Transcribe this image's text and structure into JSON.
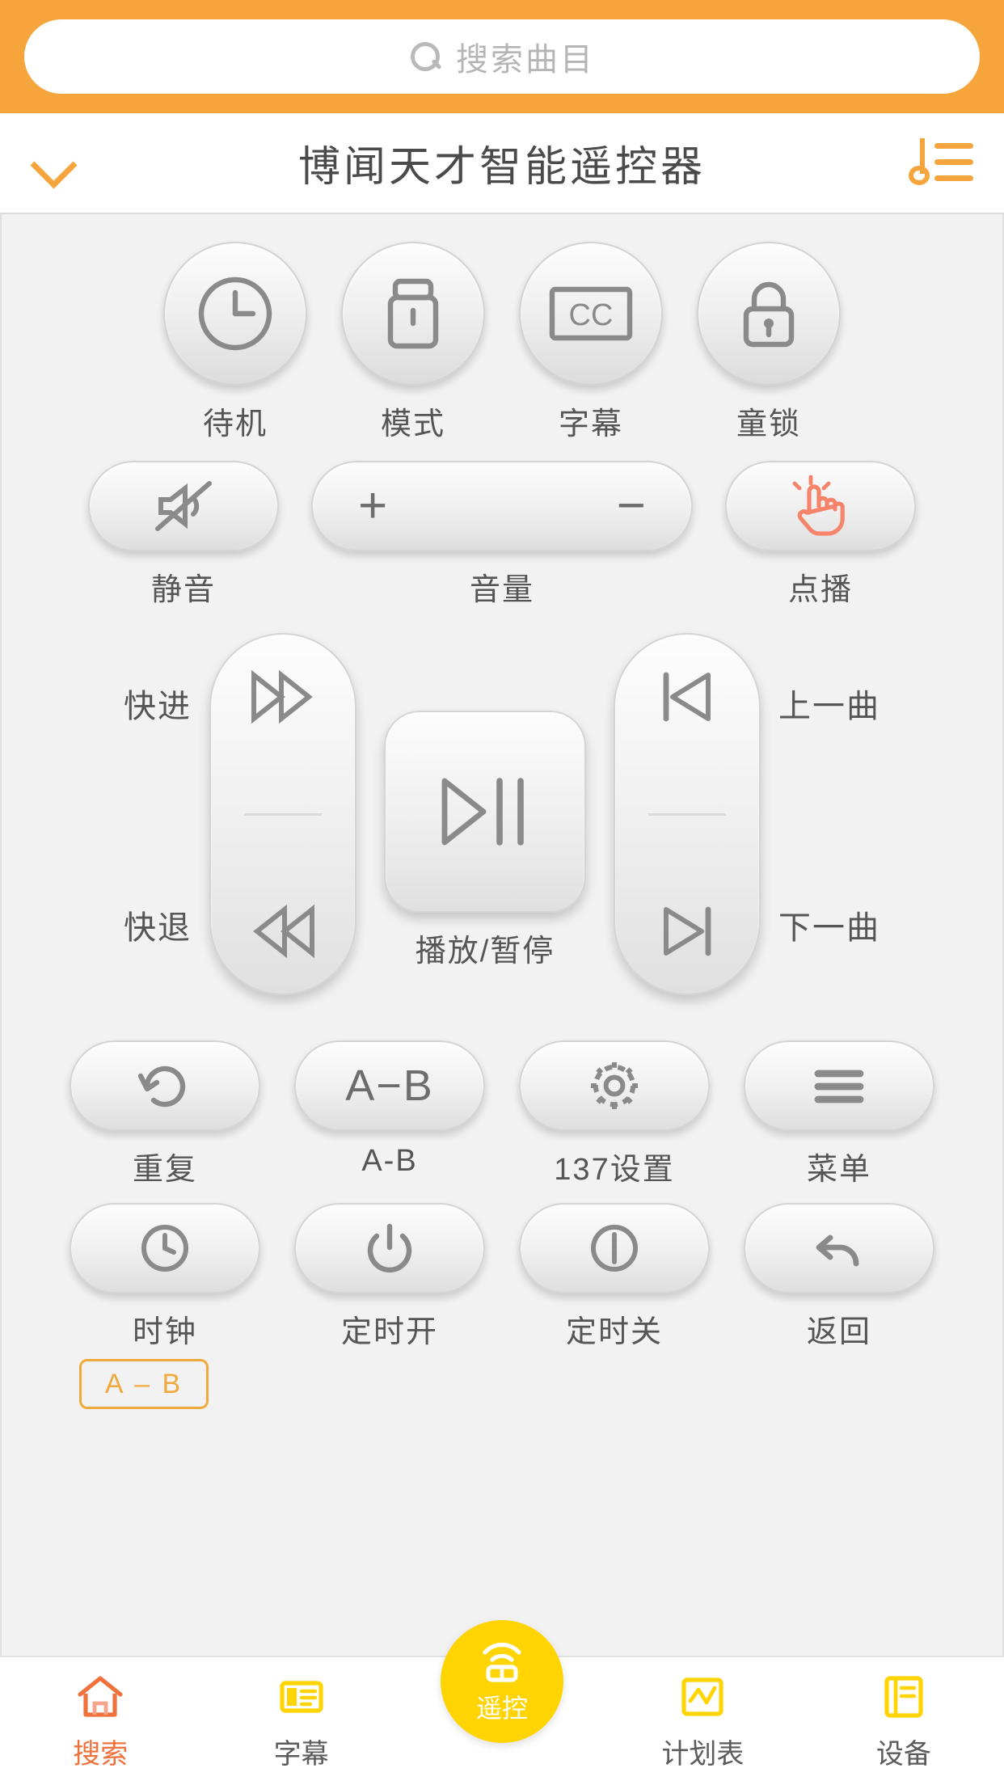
{
  "search": {
    "placeholder": "搜索曲目",
    "icon": "search-icon"
  },
  "header": {
    "title": "博闻天才智能遥控器",
    "back_icon": "chevron-down-icon",
    "playlist_icon": "music-list-icon"
  },
  "remote": {
    "row1": [
      {
        "label": "待机",
        "icon": "clock-power-icon"
      },
      {
        "label": "模式",
        "icon": "usb-drive-icon"
      },
      {
        "label": "字幕",
        "icon": "cc-icon"
      },
      {
        "label": "童锁",
        "icon": "lock-icon"
      }
    ],
    "row2": {
      "mute": {
        "label": "静音",
        "icon": "mute-icon"
      },
      "volume": {
        "label": "音量",
        "plus": "+",
        "minus": "−"
      },
      "demand": {
        "label": "点播",
        "icon": "hand-tap-icon"
      }
    },
    "transport": {
      "left_top_label": "快进",
      "left_bottom_label": "快退",
      "right_top_label": "上一曲",
      "right_bottom_label": "下一曲",
      "center_label": "播放/暂停"
    },
    "grid": [
      {
        "label": "重复",
        "icon": "repeat-icon"
      },
      {
        "label": "A-B",
        "icon": "a-b-text",
        "text": "A−B"
      },
      {
        "label": "137设置",
        "icon": "gear-icon"
      },
      {
        "label": "菜单",
        "icon": "menu-icon"
      },
      {
        "label": "时钟",
        "icon": "clock-icon"
      },
      {
        "label": "定时开",
        "icon": "power-on-icon"
      },
      {
        "label": "定时关",
        "icon": "power-off-icon"
      },
      {
        "label": "返回",
        "icon": "back-arrow-icon"
      }
    ],
    "ab_tag": "A – B"
  },
  "tabbar": {
    "items": [
      {
        "label": "搜索",
        "icon": "home-icon",
        "active": true
      },
      {
        "label": "字幕",
        "icon": "subtitle-icon",
        "active": false
      },
      {
        "label": "遥控",
        "icon": "remote-icon",
        "active": false
      },
      {
        "label": "计划表",
        "icon": "schedule-icon",
        "active": false
      },
      {
        "label": "设备",
        "icon": "device-icon",
        "active": false
      }
    ]
  },
  "colors": {
    "accent_orange": "#f5a53c",
    "accent_yellow": "#ffd400",
    "active_text": "#f0713c"
  }
}
